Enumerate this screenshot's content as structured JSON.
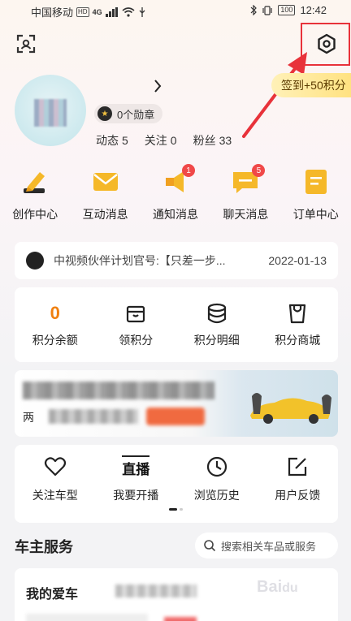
{
  "status_bar": {
    "carrier": "中国移动",
    "hd": "HD",
    "signal": "4G",
    "battery": "100",
    "time": "12:42"
  },
  "header": {
    "scan_icon": "scan-icon",
    "settings_icon": "settings-hexagon-icon"
  },
  "profile": {
    "medal_label": "0个勋章",
    "counts": [
      {
        "label": "动态",
        "value": "5"
      },
      {
        "label": "关注",
        "value": "0"
      },
      {
        "label": "粉丝",
        "value": "33"
      }
    ],
    "signin_label": "签到+50积分"
  },
  "quick_actions": [
    {
      "label": "创作中心",
      "icon": "pencil-icon",
      "badge": ""
    },
    {
      "label": "互动消息",
      "icon": "envelope-icon",
      "badge": ""
    },
    {
      "label": "通知消息",
      "icon": "megaphone-icon",
      "badge": "1"
    },
    {
      "label": "聊天消息",
      "icon": "chat-bubble-icon",
      "badge": "5"
    },
    {
      "label": "订单中心",
      "icon": "order-list-icon",
      "badge": ""
    }
  ],
  "notice": {
    "text": "中视频伙伴计划官号:【只差一步...",
    "date": "2022-01-13"
  },
  "points": {
    "balance": "0",
    "items": [
      {
        "label": "积分余额"
      },
      {
        "label": "领积分",
        "icon": "gift-box-icon"
      },
      {
        "label": "积分明细",
        "icon": "coin-stack-icon"
      },
      {
        "label": "积分商城",
        "icon": "shopping-bag-icon"
      }
    ]
  },
  "banner": {
    "sub_prefix": "两"
  },
  "tools": [
    {
      "label": "关注车型",
      "icon": "heart-icon"
    },
    {
      "label": "我要开播",
      "icon": "live-tv-icon",
      "icon_text": "直播"
    },
    {
      "label": "浏览历史",
      "icon": "clock-icon"
    },
    {
      "label": "用户反馈",
      "icon": "edit-square-icon"
    }
  ],
  "owner_service": {
    "title": "车主服务",
    "search_placeholder": "搜索相关车品或服务",
    "my_car_title": "我的爱车"
  },
  "colors": {
    "accent_orange": "#f08010",
    "badge_red": "#f04848",
    "highlight_red": "#e8323a"
  }
}
